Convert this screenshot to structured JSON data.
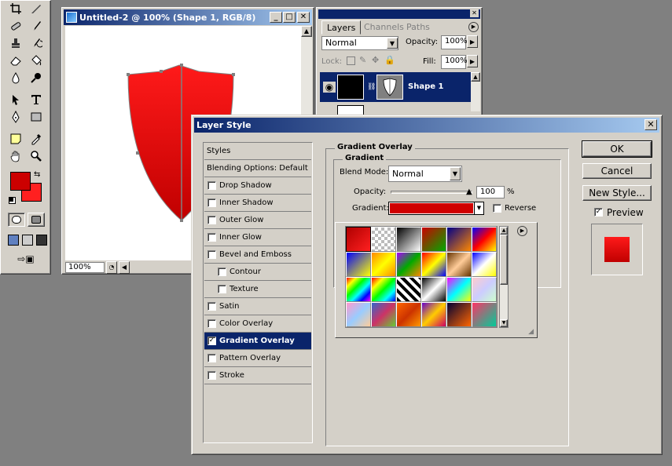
{
  "document": {
    "title": "Untitled-2 @ 100% (Shape 1, RGB/8)",
    "zoom": "100%"
  },
  "layers_palette": {
    "tabs": [
      "Layers",
      "Channels",
      "Paths"
    ],
    "blend_mode": "Normal",
    "opacity_label": "Opacity:",
    "opacity_value": "100%",
    "lock_label": "Lock:",
    "fill_label": "Fill:",
    "fill_value": "100%",
    "layer_name": "Shape 1"
  },
  "dialog": {
    "title": "Layer Style",
    "styles": [
      {
        "label": "Styles",
        "kind": "header"
      },
      {
        "label": "Blending Options: Default",
        "kind": "header"
      },
      {
        "label": "Drop Shadow",
        "checked": false,
        "indent": false
      },
      {
        "label": "Inner Shadow",
        "checked": false,
        "indent": false
      },
      {
        "label": "Outer Glow",
        "checked": false,
        "indent": false
      },
      {
        "label": "Inner Glow",
        "checked": false,
        "indent": false
      },
      {
        "label": "Bevel and Emboss",
        "checked": false,
        "indent": false
      },
      {
        "label": "Contour",
        "checked": false,
        "indent": true
      },
      {
        "label": "Texture",
        "checked": false,
        "indent": true
      },
      {
        "label": "Satin",
        "checked": false,
        "indent": false
      },
      {
        "label": "Color Overlay",
        "checked": false,
        "indent": false
      },
      {
        "label": "Gradient Overlay",
        "checked": true,
        "indent": false,
        "selected": true
      },
      {
        "label": "Pattern Overlay",
        "checked": false,
        "indent": false
      },
      {
        "label": "Stroke",
        "checked": false,
        "indent": false
      }
    ],
    "section_title": "Gradient Overlay",
    "subsection_title": "Gradient",
    "blend_mode_label": "Blend Mode:",
    "blend_mode_value": "Normal",
    "opacity_label": "Opacity:",
    "opacity_value": "100",
    "opacity_unit": "%",
    "opacity_level": 1.0,
    "gradient_label": "Gradient:",
    "reverse_label": "Reverse",
    "reverse_checked": false,
    "buttons": {
      "ok": "OK",
      "cancel": "Cancel",
      "new_style": "New Style..."
    },
    "preview_label": "Preview",
    "preview_checked": true
  },
  "colors": {
    "foreground": "#cc0000",
    "background": "#ff2020",
    "selection": "#0a246a",
    "shield_top": "#ff1a1a",
    "shield_bottom": "#c00000"
  },
  "gradient_swatches": [
    [
      "linear-gradient(135deg,#b00000,#ff2020)",
      "repeating-conic-gradient(#bbb 0% 25%,#fff 0% 50%) 0 0/8px 8px",
      "linear-gradient(135deg,#000,#fff)",
      "linear-gradient(135deg,#c00,#0a0)",
      "linear-gradient(135deg,#008,#f80)",
      "linear-gradient(135deg,#00f,#f00,#ff0)"
    ],
    [
      "linear-gradient(135deg,#00f,#ff0)",
      "linear-gradient(135deg,#f80,#ff0,#f80)",
      "linear-gradient(135deg,#a0f,#0a0,#f80)",
      "linear-gradient(135deg,#f00,#ff0,#00f)",
      "linear-gradient(135deg,#630,#fc9,#630)",
      "linear-gradient(135deg,#00f,#fff,#ff0)"
    ],
    [
      "linear-gradient(135deg,#f00,#ff0,#0f0,#0ff,#00f,#f0f)",
      "linear-gradient(135deg,#f00,#ff0,#0f0,#0ff,#00f)",
      "repeating-linear-gradient(45deg,#000 0 4px,#fff 4px 8px)",
      "linear-gradient(135deg,#000,#fff,#000)",
      "linear-gradient(135deg,#f0f,#0ff,#ff0)",
      "linear-gradient(135deg,#fcc,#ccf,#cfc)"
    ],
    [
      "linear-gradient(135deg,#f9c,#9cf,#fc9)",
      "linear-gradient(135deg,#36c,#c36,#6c3)",
      "linear-gradient(135deg,#f60,#c30,#f90)",
      "linear-gradient(135deg,#60c,#fc0,#c06)",
      "linear-gradient(135deg,#003,#f60)",
      "linear-gradient(135deg,#f36,#0c9)"
    ]
  ]
}
